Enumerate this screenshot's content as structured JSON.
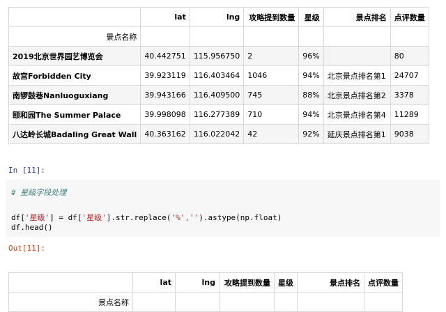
{
  "output_table_top": {
    "columns": [
      "",
      "lat",
      "lng",
      "攻略提到数量",
      "星级",
      "景点排名",
      "点评数量"
    ],
    "index_name": "景点名称",
    "rows": [
      {
        "name": "2019北京世界园艺博览会",
        "lat": "40.442751",
        "lng": "115.956750",
        "mentions": "2",
        "stars": "96%",
        "rank": "",
        "reviews": "80"
      },
      {
        "name": "故宫Forbidden City",
        "lat": "39.923119",
        "lng": "116.403464",
        "mentions": "1046",
        "stars": "94%",
        "rank": "北京景点排名第1",
        "reviews": "24707"
      },
      {
        "name": "南锣鼓巷Nanluoguxiang",
        "lat": "39.943166",
        "lng": "116.409500",
        "mentions": "745",
        "stars": "88%",
        "rank": "北京景点排名第2",
        "reviews": "3378"
      },
      {
        "name": "颐和园The Summer Palace",
        "lat": "39.998098",
        "lng": "116.277389",
        "mentions": "710",
        "stars": "94%",
        "rank": "北京景点排名第4",
        "reviews": "11289"
      },
      {
        "name": "八达岭长城Badaling Great Wall",
        "lat": "40.363162",
        "lng": "116.022042",
        "mentions": "42",
        "stars": "92%",
        "rank": "延庆景点排名第1",
        "reviews": "9038"
      }
    ]
  },
  "input_prompt": "In [11]:",
  "code_cell": {
    "comment": "# 星级字段处理",
    "line1": {
      "a": "df[",
      "s1": "'星级'",
      "b": "] = df[",
      "s2": "'星级'",
      "c": "].str.replace(",
      "s3": "'%'",
      "d": ",",
      "s4": "''",
      "e": ").astype(np.float)"
    },
    "line2": "df.head()"
  },
  "output_prompt": "Out[11]:",
  "output_table_bottom": {
    "columns": [
      "",
      "lat",
      "lng",
      "攻略提到数量",
      "星级",
      "景点排名",
      "点评数量"
    ],
    "index_name": "景点名称"
  }
}
